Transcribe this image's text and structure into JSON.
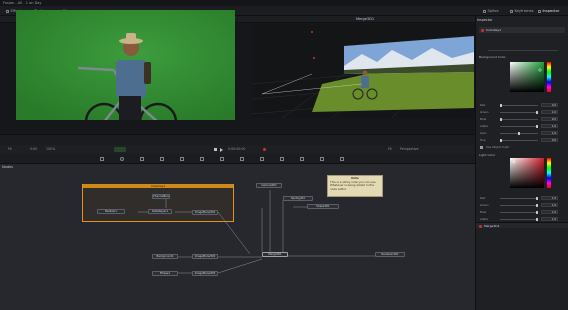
{
  "app": {
    "title": "Fusion - AE - 1 on Day"
  },
  "topbar": {
    "tabs": [
      {
        "label": "Effects"
      },
      {
        "label": "Nodes"
      },
      {
        "label": "Clips"
      }
    ],
    "right_tabs": [
      {
        "label": "Spline"
      },
      {
        "label": "Keyframes"
      },
      {
        "label": "Inspector"
      }
    ]
  },
  "viewer_left": {
    "title": "ColorKey1"
  },
  "viewer_right": {
    "title": "Merge3D1"
  },
  "viewer_strip": {
    "fit_left": "Fit",
    "zoom": "100%",
    "frame_left": "0:00",
    "time": "0:00:00:00",
    "fit_right": "Fit",
    "mode": "Perspective"
  },
  "nodes_panel": {
    "label": "Nodes",
    "underlay_label": "Underlay1",
    "note": {
      "title": "Note",
      "text": "This is a sticky note you can use. Whatever is being added in the node editor."
    },
    "nodes": [
      {
        "label": "Camera3D1"
      },
      {
        "label": "Background1"
      },
      {
        "label": "ImagePlane3D1"
      },
      {
        "label": "MediaIn1"
      },
      {
        "label": "DeltaKeyer1"
      },
      {
        "label": "ImagePlane3D2"
      },
      {
        "label": "Merge3D1"
      },
      {
        "label": "Renderer3D1"
      },
      {
        "label": "SpotLight1"
      },
      {
        "label": "Shape3D1"
      },
      {
        "label": "ImagePlane3D3"
      },
      {
        "label": "ChannelBooleans1"
      },
      {
        "label": "Background2"
      },
      {
        "label": "Ellipse1"
      }
    ]
  },
  "inspector": {
    "header": "Inspector",
    "node_name": "ColorKey1",
    "section1": "Background Color",
    "section2": "Light Color",
    "rows": [
      {
        "label": "Red",
        "value": "0.0"
      },
      {
        "label": "Green",
        "value": "1.0"
      },
      {
        "label": "Blue",
        "value": "0.0"
      },
      {
        "label": "Alpha",
        "value": "1.0"
      },
      {
        "label": "Gain",
        "value": "1.0"
      },
      {
        "label": "Hue",
        "value": "0.0"
      },
      {
        "label": "Sat",
        "value": "1.0"
      }
    ],
    "rows2": [
      {
        "label": "Red",
        "value": "1.0"
      },
      {
        "label": "Green",
        "value": "1.0"
      },
      {
        "label": "Blue",
        "value": "1.0"
      },
      {
        "label": "Alpha",
        "value": "1.0"
      }
    ],
    "checkbox_label": "Use Object Color",
    "footer_node": "Merge3D1",
    "colors": {
      "accent": "#e0951a",
      "green_screen": "#2f8a2f",
      "wheel_red": "#cc1f2a",
      "wheel_green": "#1fa33a"
    }
  }
}
